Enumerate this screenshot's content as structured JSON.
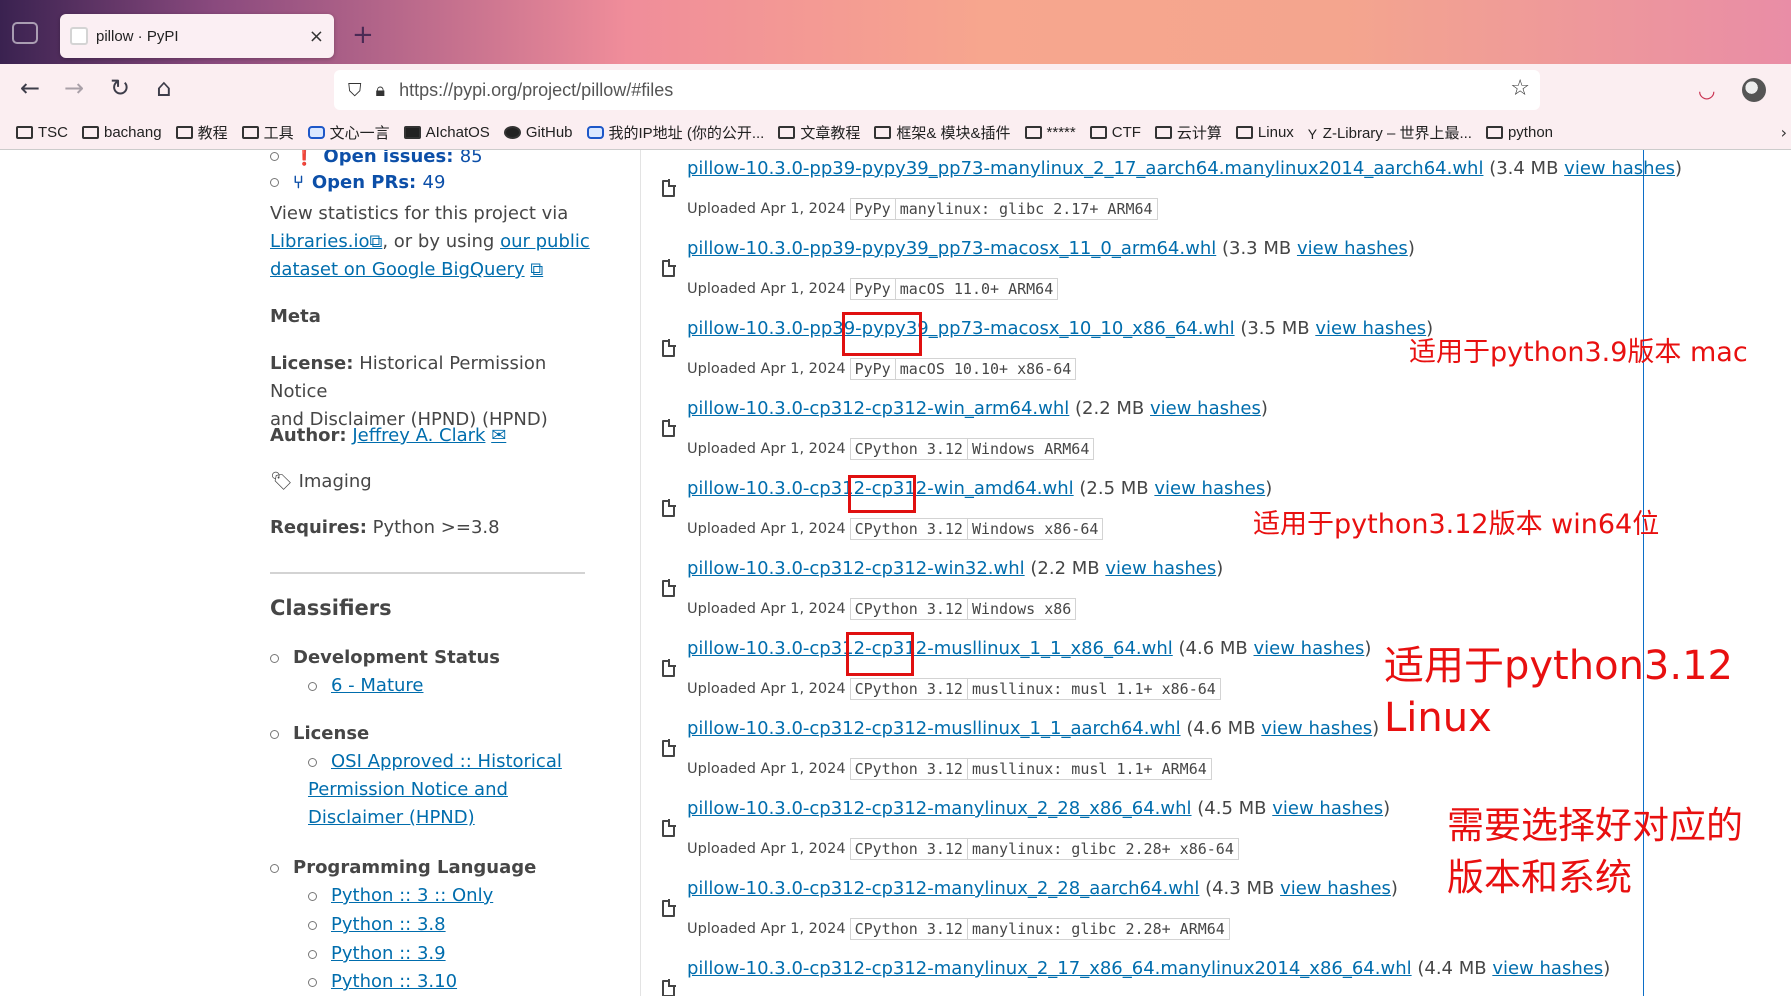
{
  "browser": {
    "tab_title": "pillow · PyPI",
    "tab_close": "×",
    "new_tab": "+",
    "url_host": "https://pypi.org",
    "url_path": "/project/pillow/#files",
    "bookmarks": [
      "TSC",
      "bachang",
      "教程",
      "工具",
      "文心一言",
      "AIchatOS",
      "GitHub",
      "我的IP地址 (你的公开...",
      "文章教程",
      "框架& 模块&插件",
      "*****",
      "CTF",
      "云计算",
      "Linux",
      "Z-Library – 世界上最...",
      "python"
    ],
    "bookmarks_more": "›"
  },
  "sidebar": {
    "open_issues_label": "Open issues:",
    "open_issues_count": "85",
    "open_prs_label": "Open PRs:",
    "open_prs_count": "49",
    "stats_text_1": "View statistics for this project via",
    "stats_link_1": "Libraries.io",
    "stats_text_2": ", or by using",
    "stats_link_2": "our public",
    "stats_link_3": "dataset on Google BigQuery",
    "meta_heading": "Meta",
    "license_label": "License:",
    "license_value_1": "Historical Permission Notice",
    "license_value_2": "and Disclaimer (HPND) (HPND)",
    "author_label": "Author:",
    "author_name": "Jeffrey A. Clark",
    "tag_imaging": "Imaging",
    "requires_label": "Requires:",
    "requires_value": "Python >=3.8",
    "classifiers_heading": "Classifiers",
    "dev_status_label": "Development Status",
    "dev_status_value": "6 - Mature",
    "license_cls_label": "License",
    "license_cls_1": "OSI Approved :: Historical",
    "license_cls_2": "Permission Notice and",
    "license_cls_3": "Disclaimer (HPND)",
    "prog_lang_label": "Programming Language",
    "langs": [
      "Python :: 3 :: Only",
      "Python :: 3.8",
      "Python :: 3.9",
      "Python :: 3.10"
    ]
  },
  "files": [
    {
      "name": "pillow-10.3.0-pp39-pypy39_pp73-manylinux_2_17_aarch64.manylinux2014_aarch64.whl",
      "size": "(3.4 MB",
      "hashes": "view hashes",
      "uploaded": "Uploaded Apr 1, 2024",
      "tags": [
        "PyPy",
        "manylinux: glibc 2.17+ ARM64"
      ]
    },
    {
      "name": "pillow-10.3.0-pp39-pypy39_pp73-macosx_11_0_arm64.whl",
      "size": "(3.3 MB",
      "hashes": "view hashes",
      "uploaded": "Uploaded Apr 1, 2024",
      "tags": [
        "PyPy",
        "macOS 11.0+ ARM64"
      ]
    },
    {
      "name": "pillow-10.3.0-pp39-pypy39_pp73-macosx_10_10_x86_64.whl",
      "size": "(3.5 MB",
      "hashes": "view hashes",
      "uploaded": "Uploaded Apr 1, 2024",
      "tags": [
        "PyPy",
        "macOS 10.10+ x86-64"
      ]
    },
    {
      "name": "pillow-10.3.0-cp312-cp312-win_arm64.whl",
      "size": "(2.2 MB",
      "hashes": "view hashes",
      "uploaded": "Uploaded Apr 1, 2024",
      "tags": [
        "CPython 3.12",
        "Windows ARM64"
      ]
    },
    {
      "name": "pillow-10.3.0-cp312-cp312-win_amd64.whl",
      "size": "(2.5 MB",
      "hashes": "view hashes",
      "uploaded": "Uploaded Apr 1, 2024",
      "tags": [
        "CPython 3.12",
        "Windows x86-64"
      ]
    },
    {
      "name": "pillow-10.3.0-cp312-cp312-win32.whl",
      "size": "(2.2 MB",
      "hashes": "view hashes",
      "uploaded": "Uploaded Apr 1, 2024",
      "tags": [
        "CPython 3.12",
        "Windows x86"
      ]
    },
    {
      "name": "pillow-10.3.0-cp312-cp312-musllinux_1_1_x86_64.whl",
      "size": "(4.6 MB",
      "hashes": "view hashes",
      "uploaded": "Uploaded Apr 1, 2024",
      "tags": [
        "CPython 3.12",
        "musllinux: musl 1.1+ x86-64"
      ]
    },
    {
      "name": "pillow-10.3.0-cp312-cp312-musllinux_1_1_aarch64.whl",
      "size": "(4.6 MB",
      "hashes": "view hashes",
      "uploaded": "Uploaded Apr 1, 2024",
      "tags": [
        "CPython 3.12",
        "musllinux: musl 1.1+ ARM64"
      ]
    },
    {
      "name": "pillow-10.3.0-cp312-cp312-manylinux_2_28_x86_64.whl",
      "size": "(4.5 MB",
      "hashes": "view hashes",
      "uploaded": "Uploaded Apr 1, 2024",
      "tags": [
        "CPython 3.12",
        "manylinux: glibc 2.28+ x86-64"
      ]
    },
    {
      "name": "pillow-10.3.0-cp312-cp312-manylinux_2_28_aarch64.whl",
      "size": "(4.3 MB",
      "hashes": "view hashes",
      "uploaded": "Uploaded Apr 1, 2024",
      "tags": [
        "CPython 3.12",
        "manylinux: glibc 2.28+ ARM64"
      ]
    },
    {
      "name": "pillow-10.3.0-cp312-cp312-manylinux_2_17_x86_64.manylinux2014_x86_64.whl",
      "size": "(4.4 MB",
      "hashes": "view hashes",
      "uploaded": "",
      "tags": []
    }
  ],
  "annotations": {
    "mac_note": "适用于python3.9版本 mac",
    "win_note": "适用于python3.12版本 win64位",
    "linux_note_1": "适用于python3.12",
    "linux_note_2": "Linux",
    "choose_note_1": "需要选择好对应的",
    "choose_note_2": "版本和系统"
  },
  "colors": {
    "link": "#006dad",
    "annotation_red": "#e81010",
    "pypi_blue": "#0c4fa8"
  }
}
